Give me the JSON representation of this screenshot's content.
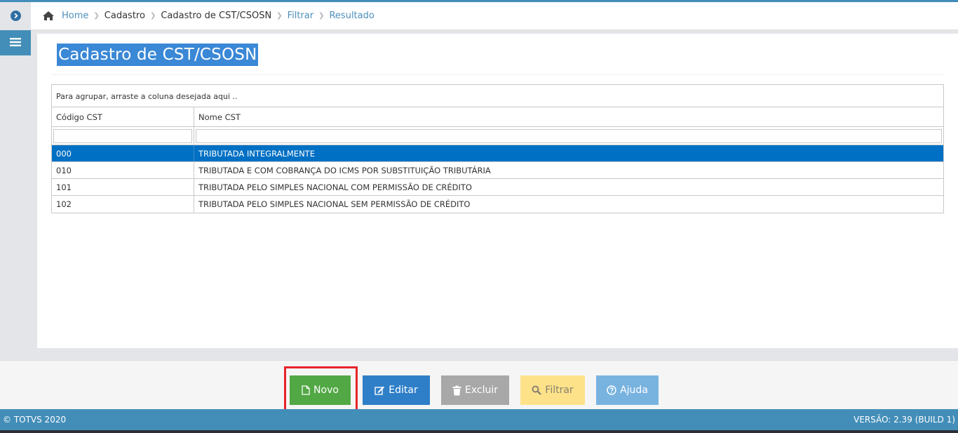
{
  "breadcrumb": {
    "home": "Home",
    "items": [
      "Cadastro",
      "Cadastro de CST/CSOSN",
      "Filtrar",
      "Resultado"
    ]
  },
  "page": {
    "title": "Cadastro de CST/CSOSN"
  },
  "grid": {
    "group_hint": "Para agrupar, arraste a coluna desejada aqui ..",
    "columns": [
      "Código CST",
      "Nome CST"
    ],
    "filter_values": [
      "",
      ""
    ],
    "rows": [
      {
        "codigo": "000",
        "nome": "TRIBUTADA INTEGRALMENTE",
        "selected": true
      },
      {
        "codigo": "010",
        "nome": "TRIBUTADA E COM COBRANÇA DO ICMS POR SUBSTITUIÇÃO TRIBUTÁRIA",
        "selected": false
      },
      {
        "codigo": "101",
        "nome": "TRIBUTADA PELO SIMPLES NACIONAL COM PERMISSÃO DE CRÉDITO",
        "selected": false
      },
      {
        "codigo": "102",
        "nome": "TRIBUTADA PELO SIMPLES NACIONAL SEM PERMISSÃO DE CRÉDITO",
        "selected": false
      }
    ]
  },
  "toolbar": {
    "novo": "Novo",
    "editar": "Editar",
    "excluir": "Excluir",
    "filtrar": "Filtrar",
    "ajuda": "Ajuda"
  },
  "footer": {
    "copyright": "© TOTVS 2020",
    "version": "VERSÃO: 2.39 (BUILD 1)"
  },
  "icons": {
    "sidebar_toggle": "chevron-right-circle-icon",
    "menu": "hamburger-menu-icon",
    "home": "home-icon",
    "novo": "file-icon",
    "editar": "edit-icon",
    "excluir": "trash-icon",
    "filtrar": "search-icon",
    "ajuda": "help-circle-icon"
  },
  "colors": {
    "accent": "#438eb9",
    "selected_row": "#0070c4",
    "novo": "#52a844",
    "editar": "#2f7fc8",
    "excluir": "#a8a8a8",
    "filtrar": "#fde28a",
    "ajuda": "#78b3e0",
    "highlight": "#e8232a"
  }
}
